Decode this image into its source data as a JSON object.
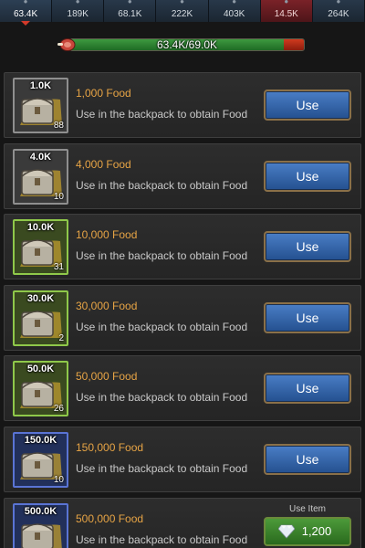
{
  "resource_tabs": [
    {
      "value": "63.4K",
      "icon": "meat-icon",
      "state": "active"
    },
    {
      "value": "189K",
      "icon": "stone-icon",
      "state": "normal"
    },
    {
      "value": "68.1K",
      "icon": "wood-icon",
      "state": "normal"
    },
    {
      "value": "222K",
      "icon": "ore-icon",
      "state": "normal"
    },
    {
      "value": "403K",
      "icon": "gem-icon",
      "state": "normal"
    },
    {
      "value": "14.5K",
      "icon": "fire-icon",
      "state": "alert"
    },
    {
      "value": "264K",
      "icon": "gold-icon",
      "state": "normal"
    }
  ],
  "capacity": {
    "text": "63.4K/69.0K",
    "fill_fraction": 0.919,
    "colors": {
      "fill": "#2f8a35",
      "over": "#c0311a"
    }
  },
  "items": [
    {
      "thumb_amount": "1.0K",
      "count": "88",
      "name": "1,000 Food",
      "desc": "Use in the backpack to obtain Food",
      "tier": "gray",
      "action": "Use"
    },
    {
      "thumb_amount": "4.0K",
      "count": "10",
      "name": "4,000 Food",
      "desc": "Use in the backpack to obtain Food",
      "tier": "gray",
      "action": "Use"
    },
    {
      "thumb_amount": "10.0K",
      "count": "31",
      "name": "10,000 Food",
      "desc": "Use in the backpack to obtain Food",
      "tier": "green",
      "action": "Use"
    },
    {
      "thumb_amount": "30.0K",
      "count": "2",
      "name": "30,000 Food",
      "desc": "Use in the backpack to obtain Food",
      "tier": "green",
      "action": "Use"
    },
    {
      "thumb_amount": "50.0K",
      "count": "26",
      "name": "50,000 Food",
      "desc": "Use in the backpack to obtain Food",
      "tier": "green",
      "action": "Use"
    },
    {
      "thumb_amount": "150.0K",
      "count": "10",
      "name": "150,000 Food",
      "desc": "Use in the backpack to obtain Food",
      "tier": "blue",
      "action": "Use"
    }
  ],
  "last_item": {
    "thumb_amount": "500.0K",
    "name": "500,000 Food",
    "desc": "Use in the backpack to obtain Food",
    "tier": "blue",
    "use_item_label": "Use Item",
    "gem_cost": "1,200"
  },
  "colors": {
    "item_name": "#e7a445",
    "use_button": "#2f5fa8",
    "gem_button": "#3c8a2e",
    "tier_green": "#8fc84a",
    "tier_blue": "#5a74d4"
  }
}
